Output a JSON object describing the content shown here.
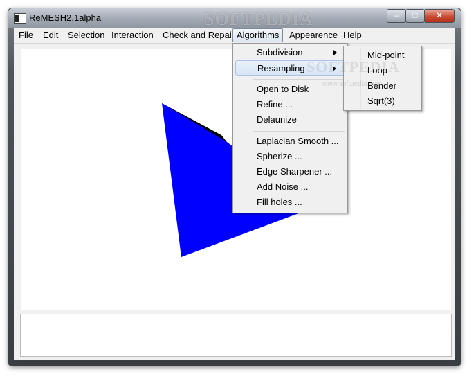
{
  "window": {
    "title": "ReMESH2.1alpha",
    "watermark": "SOFTPEDIA",
    "controls": {
      "minimize": "–",
      "maximize": "□",
      "close": "✕"
    }
  },
  "menubar": {
    "items": [
      "File",
      "Edit",
      "Selection",
      "Interaction",
      "Check and Repair",
      "Algorithms",
      "Appearence",
      "Help"
    ],
    "active": "Algorithms"
  },
  "algorithms_menu": {
    "items": [
      "Subdivision",
      "Resampling",
      "Open to Disk",
      "Refine ...",
      "Delaunize",
      "Laplacian Smooth ...",
      "Spherize ...",
      "Edge Sharpener ...",
      "Add Noise ...",
      "Fill holes ..."
    ],
    "highlighted": "Resampling"
  },
  "subdivision_submenu": {
    "items": [
      "Mid-point",
      "Loop",
      "Bender",
      "Sqrt(3)"
    ]
  },
  "viewport": {
    "mesh_color": "#0000ff",
    "background": "#ffffff",
    "watermark": "SOFTPEDIA",
    "watermark_sub": "www.softpedia.com"
  },
  "console": {
    "text": ""
  }
}
